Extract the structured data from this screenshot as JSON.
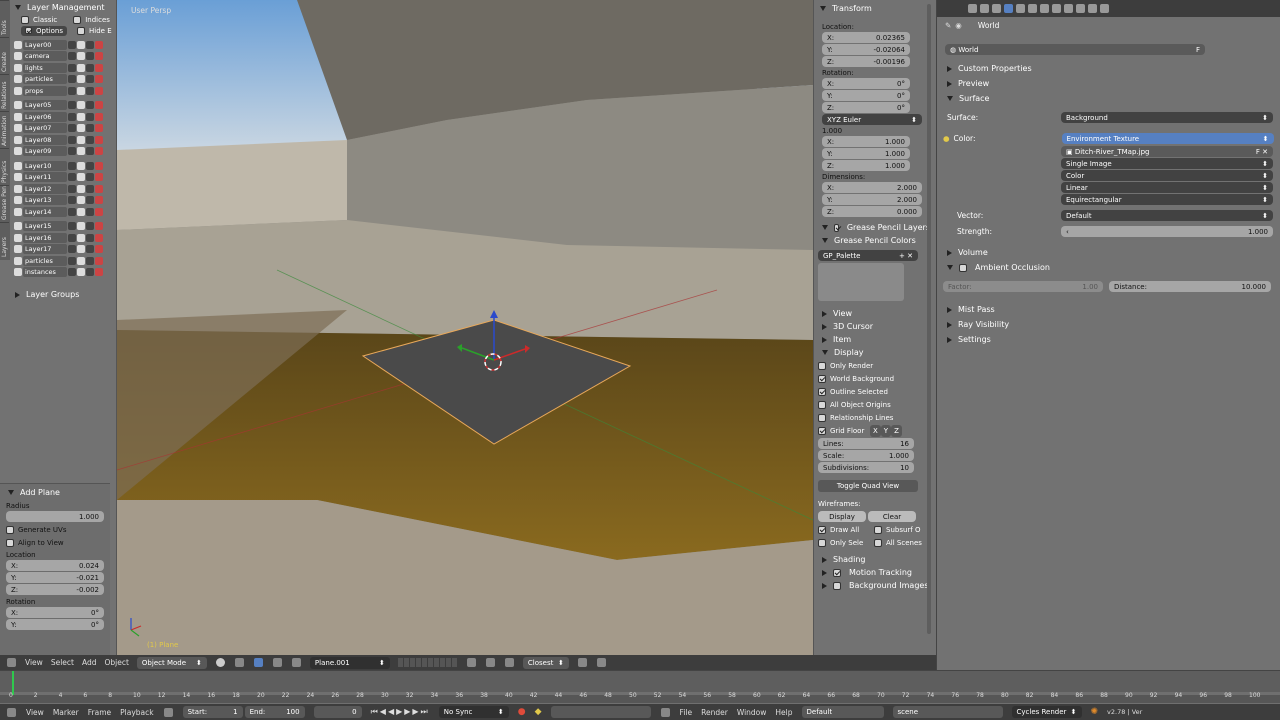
{
  "viewport": {
    "label": "User Persp",
    "object_label": "(1) Plane"
  },
  "layer_panel": {
    "title": "Layer Management",
    "classic": "Classic",
    "indices": "Indices",
    "options": "Options",
    "hide_e": "Hide E",
    "layers": [
      "Layer00",
      "camera",
      "lights",
      "particles",
      "props",
      "Layer05",
      "Layer06",
      "Layer07",
      "Layer08",
      "Layer09",
      "Layer10",
      "Layer11",
      "Layer12",
      "Layer13",
      "Layer14",
      "Layer15",
      "Layer16",
      "Layer17",
      "particles",
      "instances"
    ],
    "layer_groups": "Layer Groups"
  },
  "side_tabs": [
    "Tools",
    "Create",
    "Relations",
    "Animation",
    "Physics",
    "Grease Pencil",
    "Layers"
  ],
  "operator_panel": {
    "title": "Add Plane",
    "radius_label": "Radius",
    "radius": "1.000",
    "gen_uvs": "Generate UVs",
    "align": "Align to View",
    "location_label": "Location",
    "lx": "0.024",
    "ly": "-0.021",
    "lz": "-0.002",
    "rotation_label": "Rotation",
    "rx": "0°",
    "ry": "0°"
  },
  "n_panel": {
    "transform": "Transform",
    "location": "Location:",
    "x": "0.02365",
    "y": "-0.02064",
    "z": "-0.00196",
    "rotation": "Rotation:",
    "rotx": "0°",
    "roty": "0°",
    "rotz": "0°",
    "euler": "XYZ Euler",
    "scale": "1.000",
    "sx": "1.000",
    "sy": "1.000",
    "sz": "1.000",
    "dimensions": "Dimensions:",
    "dx": "2.000",
    "dy": "2.000",
    "dz": "0.000",
    "gp_layers": "Grease Pencil Layers",
    "gp_colors": "Grease Pencil Colors",
    "gp_palette": "GP_Palette",
    "view": "View",
    "cursor": "3D Cursor",
    "item": "Item",
    "display": "Display",
    "only_render": "Only Render",
    "world_bg": "World Background",
    "outline": "Outline Selected",
    "all_origins": "All Object Origins",
    "rel_lines": "Relationship Lines",
    "grid_floor": "Grid Floor",
    "gx": "X",
    "gy": "Y",
    "gz": "Z",
    "lines_l": "Lines:",
    "lines": "16",
    "scale_l": "Scale:",
    "subdiv_l": "Subdivisions:",
    "subdiv": "10",
    "quad": "Toggle Quad View",
    "wireframes": "Wireframes:",
    "wdisplay": "Display",
    "wclear": "Clear",
    "draw_all": "Draw All",
    "subsurf": "Subsurf O",
    "only_sele": "Only Sele",
    "all_scenes": "All Scenes",
    "shading": "Shading",
    "motion": "Motion Tracking",
    "bg_images": "Background Images"
  },
  "props": {
    "world_ctx": "World",
    "world_name": "World",
    "f": "F",
    "custom": "Custom Properties",
    "preview": "Preview",
    "surface": "Surface",
    "surface_l": "Surface:",
    "surface_v": "Background",
    "color_l": "Color:",
    "color_v": "Environment Texture",
    "img": "Ditch-River_TMap.jpg",
    "single": "Single Image",
    "color": "Color",
    "linear": "Linear",
    "equirect": "Equirectangular",
    "vector_l": "Vector:",
    "vector_v": "Default",
    "strength_l": "Strength:",
    "strength": "1.000",
    "volume": "Volume",
    "ao": "Ambient Occlusion",
    "factor_l": "Factor:",
    "factor": "1.00",
    "distance_l": "Distance:",
    "distance": "10.000",
    "mist": "Mist Pass",
    "ray": "Ray Visibility",
    "settings": "Settings"
  },
  "viewport_header": {
    "view": "View",
    "select": "Select",
    "add": "Add",
    "object": "Object",
    "mode": "Object Mode",
    "plane": "Plane.001",
    "closest": "Closest"
  },
  "timeline": {
    "ticks": [
      "0",
      "2",
      "4",
      "6",
      "8",
      "10",
      "12",
      "14",
      "16",
      "18",
      "20",
      "22",
      "24",
      "26",
      "28",
      "30",
      "32",
      "34",
      "36",
      "38",
      "40",
      "42",
      "44",
      "46",
      "48",
      "50",
      "52",
      "54",
      "56",
      "58",
      "60",
      "62",
      "64",
      "66",
      "68",
      "70",
      "72",
      "74",
      "76",
      "78",
      "80",
      "82",
      "84",
      "86",
      "88",
      "90",
      "92",
      "94",
      "96",
      "98",
      "100"
    ]
  },
  "bottom_bar": {
    "view": "View",
    "marker": "Marker",
    "frame": "Frame",
    "playback": "Playback",
    "start_l": "Start:",
    "start": "1",
    "end_l": "End:",
    "end": "100",
    "current": "0",
    "sync": "No Sync",
    "file": "File",
    "render": "Render",
    "window": "Window",
    "help": "Help",
    "layout": "Default",
    "scene": "scene",
    "engine": "Cycles Render",
    "version": "v2.78 | Ver"
  }
}
